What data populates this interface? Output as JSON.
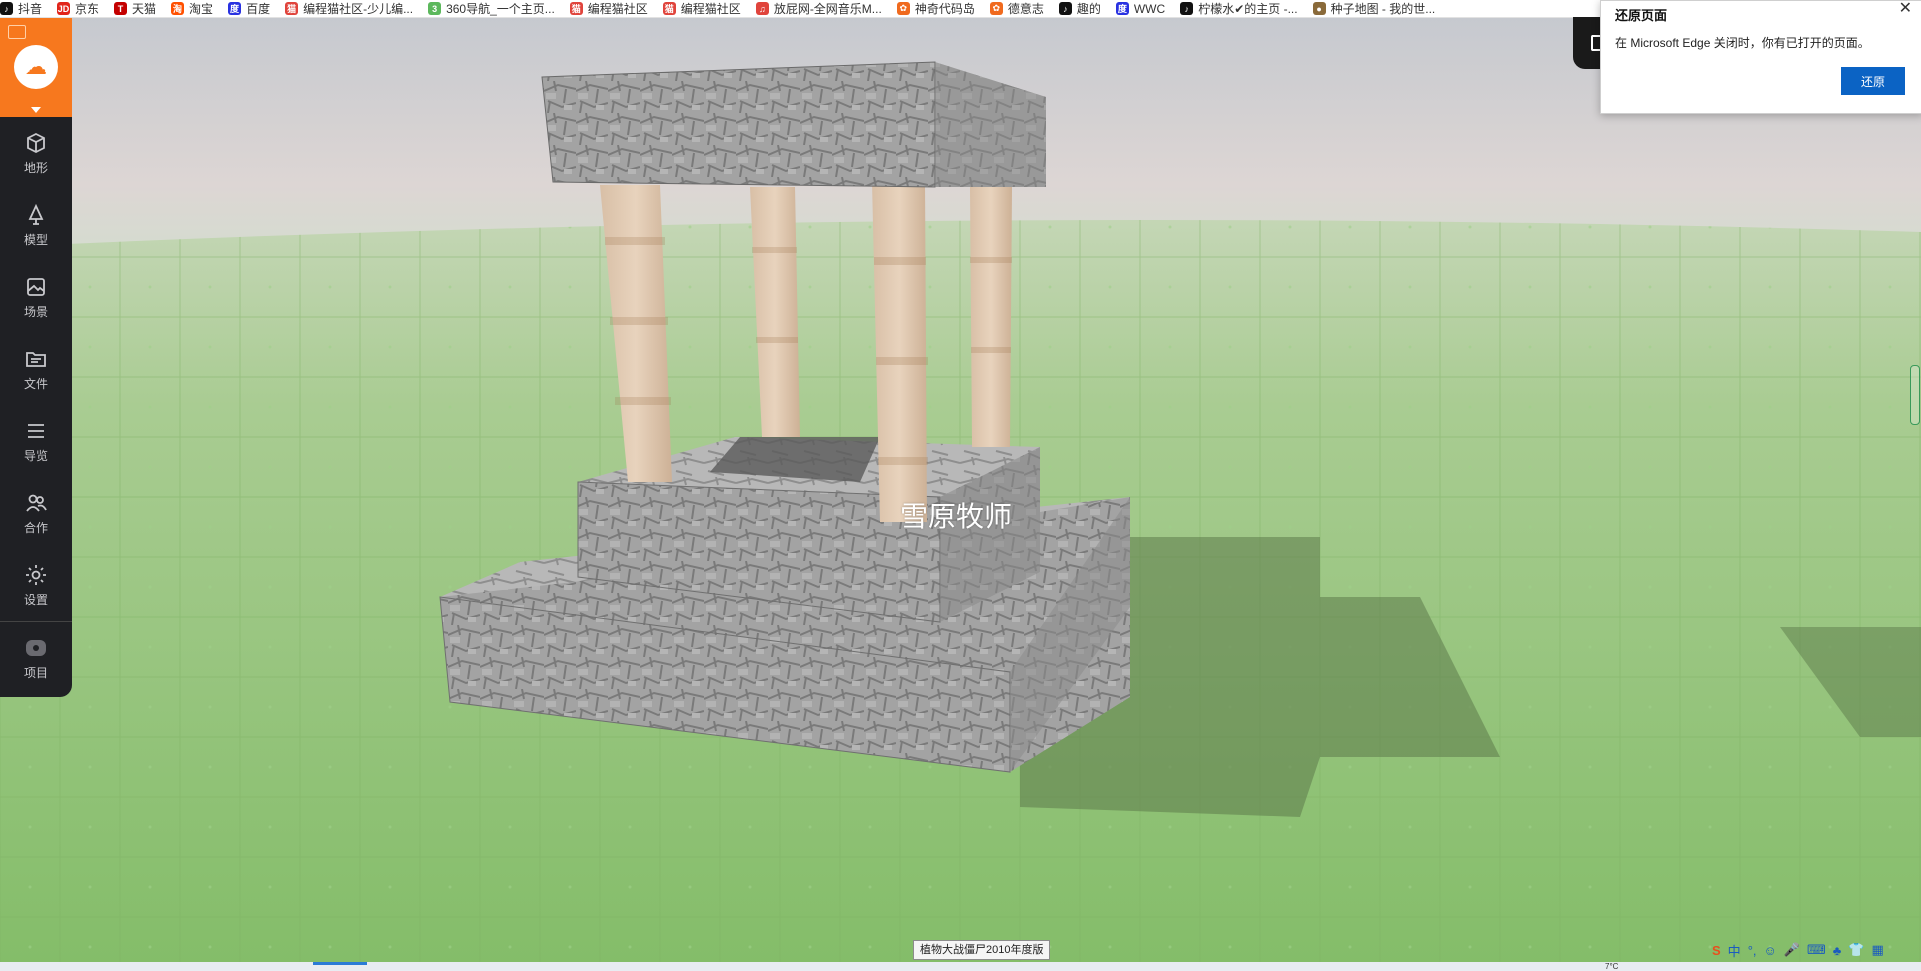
{
  "bookmarks": [
    {
      "label": "抖音",
      "icon": "tiktok-icon",
      "color": "#111111",
      "glyph": "♪"
    },
    {
      "label": "京东",
      "icon": "jd-icon",
      "color": "#e1251b",
      "glyph": "JD"
    },
    {
      "label": "天猫",
      "icon": "tmall-icon",
      "color": "#c40000",
      "glyph": "T"
    },
    {
      "label": "淘宝",
      "icon": "taobao-icon",
      "color": "#ff5000",
      "glyph": "淘"
    },
    {
      "label": "百度",
      "icon": "baidu-icon",
      "color": "#2932e1",
      "glyph": "度"
    },
    {
      "label": "编程猫社区-少儿编...",
      "icon": "codemao-icon",
      "color": "#e0443c",
      "glyph": "猫"
    },
    {
      "label": "360导航_一个主页...",
      "icon": "360-icon",
      "color": "#5cb85c",
      "glyph": "3"
    },
    {
      "label": "编程猫社区",
      "icon": "codemao-icon",
      "color": "#e0443c",
      "glyph": "猫"
    },
    {
      "label": "编程猫社区",
      "icon": "codemao-icon",
      "color": "#e0443c",
      "glyph": "猫"
    },
    {
      "label": "放屁网-全网音乐M...",
      "icon": "music-icon",
      "color": "#e0443c",
      "glyph": "♫"
    },
    {
      "label": "神奇代码岛",
      "icon": "flower-icon",
      "color": "#f06a1e",
      "glyph": "✿"
    },
    {
      "label": "德意志",
      "icon": "flower-icon",
      "color": "#f06a1e",
      "glyph": "✿"
    },
    {
      "label": "趣的",
      "icon": "tiktok-icon",
      "color": "#111111",
      "glyph": "♪"
    },
    {
      "label": "WWC",
      "icon": "baidu-icon",
      "color": "#2932e1",
      "glyph": "度"
    },
    {
      "label": "柠檬水✔的主页 -...",
      "icon": "tiktok-icon",
      "color": "#111111",
      "glyph": "♪"
    },
    {
      "label": "种子地图 - 我的世...",
      "icon": "seed-icon",
      "color": "#8a6a3a",
      "glyph": "●"
    }
  ],
  "sidebar": {
    "items": [
      {
        "label": "地形",
        "icon": "cube-icon"
      },
      {
        "label": "模型",
        "icon": "tree-icon"
      },
      {
        "label": "场景",
        "icon": "image-icon"
      },
      {
        "label": "文件",
        "icon": "folder-icon"
      },
      {
        "label": "导览",
        "icon": "list-icon"
      },
      {
        "label": "合作",
        "icon": "users-icon"
      },
      {
        "label": "设置",
        "icon": "gear-icon"
      }
    ],
    "project": {
      "label": "项目",
      "icon": "project-icon"
    }
  },
  "popup": {
    "title": "还原页面",
    "message": "在 Microsoft Edge 关闭时，你有已打开的页面。",
    "button": "还原",
    "close": "✕"
  },
  "scene": {
    "nametag": "雪原牧师"
  },
  "tooltip": "植物大战僵尸2010年度版",
  "ime": {
    "items": [
      "S",
      "中",
      "°,",
      "☺",
      "🎤",
      "⌨",
      "♣",
      "👕",
      "▦"
    ]
  },
  "taskbar": {
    "clock": "7°C"
  }
}
